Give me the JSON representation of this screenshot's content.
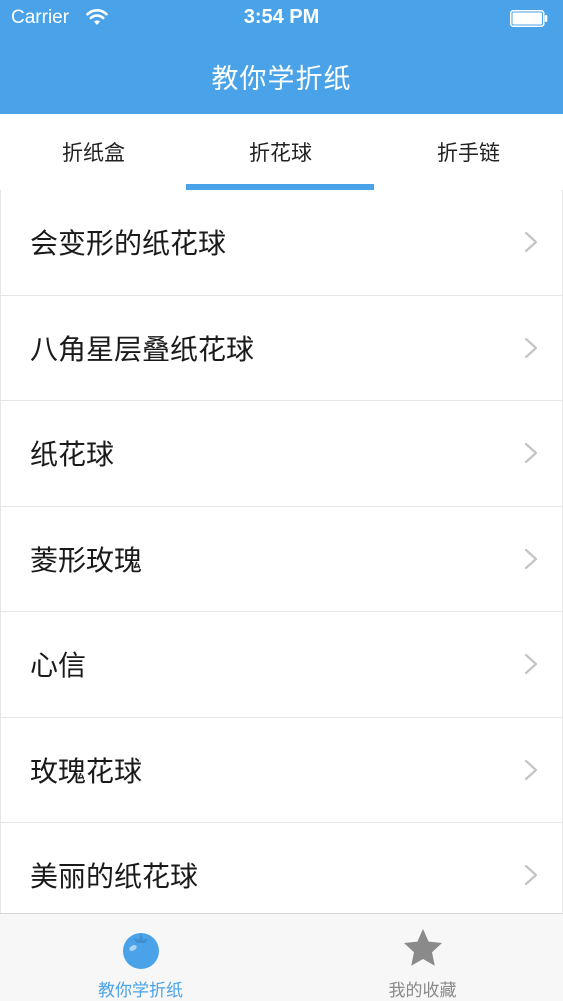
{
  "status": {
    "carrier": "Carrier",
    "time": "3:54 PM"
  },
  "nav": {
    "title": "教你学折纸"
  },
  "tabs": [
    {
      "label": "折纸盒"
    },
    {
      "label": "折花球"
    },
    {
      "label": "折手链"
    }
  ],
  "list": [
    {
      "label": "会变形的纸花球"
    },
    {
      "label": "八角星层叠纸花球"
    },
    {
      "label": "纸花球"
    },
    {
      "label": "菱形玫瑰"
    },
    {
      "label": "心信"
    },
    {
      "label": "玫瑰花球"
    },
    {
      "label": "美丽的纸花球"
    }
  ],
  "tabbar": [
    {
      "label": "教你学折纸",
      "icon": "tomato-icon"
    },
    {
      "label": "我的收藏",
      "icon": "star-icon"
    }
  ],
  "colors": {
    "accent": "#4aa3e8",
    "inactive": "#8a8a8a"
  }
}
